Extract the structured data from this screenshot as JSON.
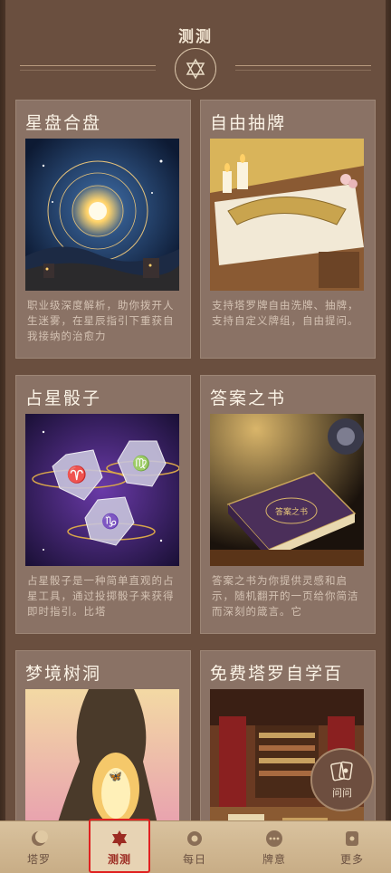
{
  "header": {
    "title": "测测",
    "emblem_icon": "star-of-david-icon"
  },
  "cards": [
    {
      "title": "星盘合盘",
      "desc": "职业级深度解析，助你拨开人生迷雾，在星辰指引下重获自我接纳的治愈力",
      "image": "astrology-wheel-image"
    },
    {
      "title": "自由抽牌",
      "desc": "支持塔罗牌自由洗牌、抽牌，支持自定义牌组，自由提问。",
      "image": "tarot-spread-image"
    },
    {
      "title": "占星骰子",
      "desc": "占星骰子是一种简单直观的占星工具，通过投掷骰子来获得即时指引。比塔",
      "image": "astro-dice-image"
    },
    {
      "title": "答案之书",
      "desc": "答案之书为你提供灵感和启示，随机翻开的一页给你简洁而深刻的箴言。它",
      "image": "book-of-answers-image"
    },
    {
      "title": "梦境树洞",
      "desc": "",
      "image": "dream-tree-image"
    },
    {
      "title": "免费塔罗自学百",
      "desc": "",
      "image": "library-image"
    }
  ],
  "book_cover_text": "答案之书",
  "float_button": {
    "label": "问问"
  },
  "tabs": [
    {
      "label": "塔罗",
      "icon": "moon-icon",
      "active": false
    },
    {
      "label": "测测",
      "icon": "star-of-david-icon",
      "active": true
    },
    {
      "label": "每日",
      "icon": "sun-icon",
      "active": false
    },
    {
      "label": "牌意",
      "icon": "dots-icon",
      "active": false
    },
    {
      "label": "更多",
      "icon": "card-icon",
      "active": false
    }
  ],
  "colors": {
    "accent": "#9c2b22",
    "tabbar": "#d9c29e",
    "card": "#8a7265",
    "background": "#6a4f3f"
  }
}
